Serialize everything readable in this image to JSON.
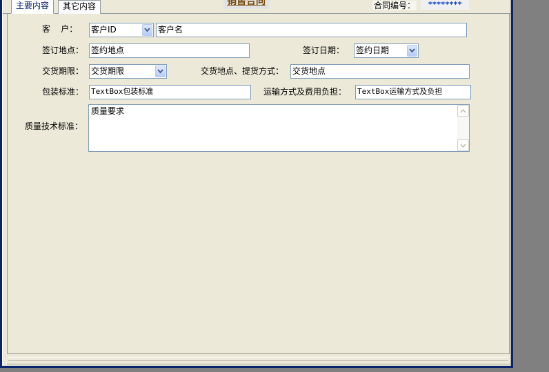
{
  "tabs": [
    {
      "label": "主要内容",
      "active": true
    },
    {
      "label": "其它内容",
      "active": false
    }
  ],
  "header": {
    "title": "销售合同",
    "contract_no_label": "合同编号：",
    "contract_no_value": "********"
  },
  "form": {
    "customer": {
      "label": "客    户：",
      "id_value": "客户ID",
      "name_value": "客户名"
    },
    "sign_place": {
      "label": "签订地点：",
      "value": "签约地点"
    },
    "sign_date": {
      "label": "签订日期：",
      "value": "签约日期"
    },
    "delivery_term": {
      "label": "交货期限：",
      "value": "交货期限"
    },
    "delivery_place": {
      "label": "交货地点、提货方式：",
      "value": "交货地点"
    },
    "packaging": {
      "label": "包装标准：",
      "value": "TextBox包装标准"
    },
    "transport": {
      "label": "运输方式及费用负担：",
      "value": "TextBox运输方式及负担"
    },
    "quality": {
      "label": "质量技术标准：",
      "value": "质量要求"
    }
  },
  "colors": {
    "window_border": "#0a246a",
    "form_bg": "#ece9d8",
    "input_border": "#7f9db9",
    "title_color": "#7a4a08",
    "contract_no_color": "#1144cc",
    "active_tab_accent": "#e68b2c"
  },
  "icons": {
    "combo_dropdown": "chevron-down-icon",
    "scroll_up": "arrow-up-icon",
    "scroll_down": "arrow-down-icon"
  }
}
